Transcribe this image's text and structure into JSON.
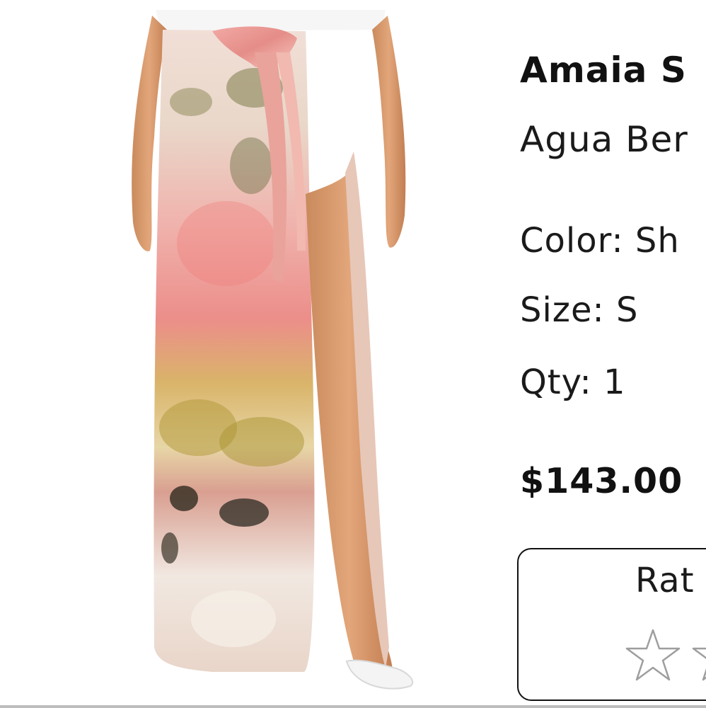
{
  "product": {
    "name": "Amaia S",
    "brand": "Agua Ber",
    "color_label": "Color: Sh",
    "size_label": "Size: S",
    "qty_label": "Qty: 1",
    "price": "$143.00"
  },
  "rating": {
    "label": "Rat",
    "stars_filled": 0,
    "star_color": "#9e9e9e"
  },
  "icons": {
    "star": "star-outline-icon"
  }
}
